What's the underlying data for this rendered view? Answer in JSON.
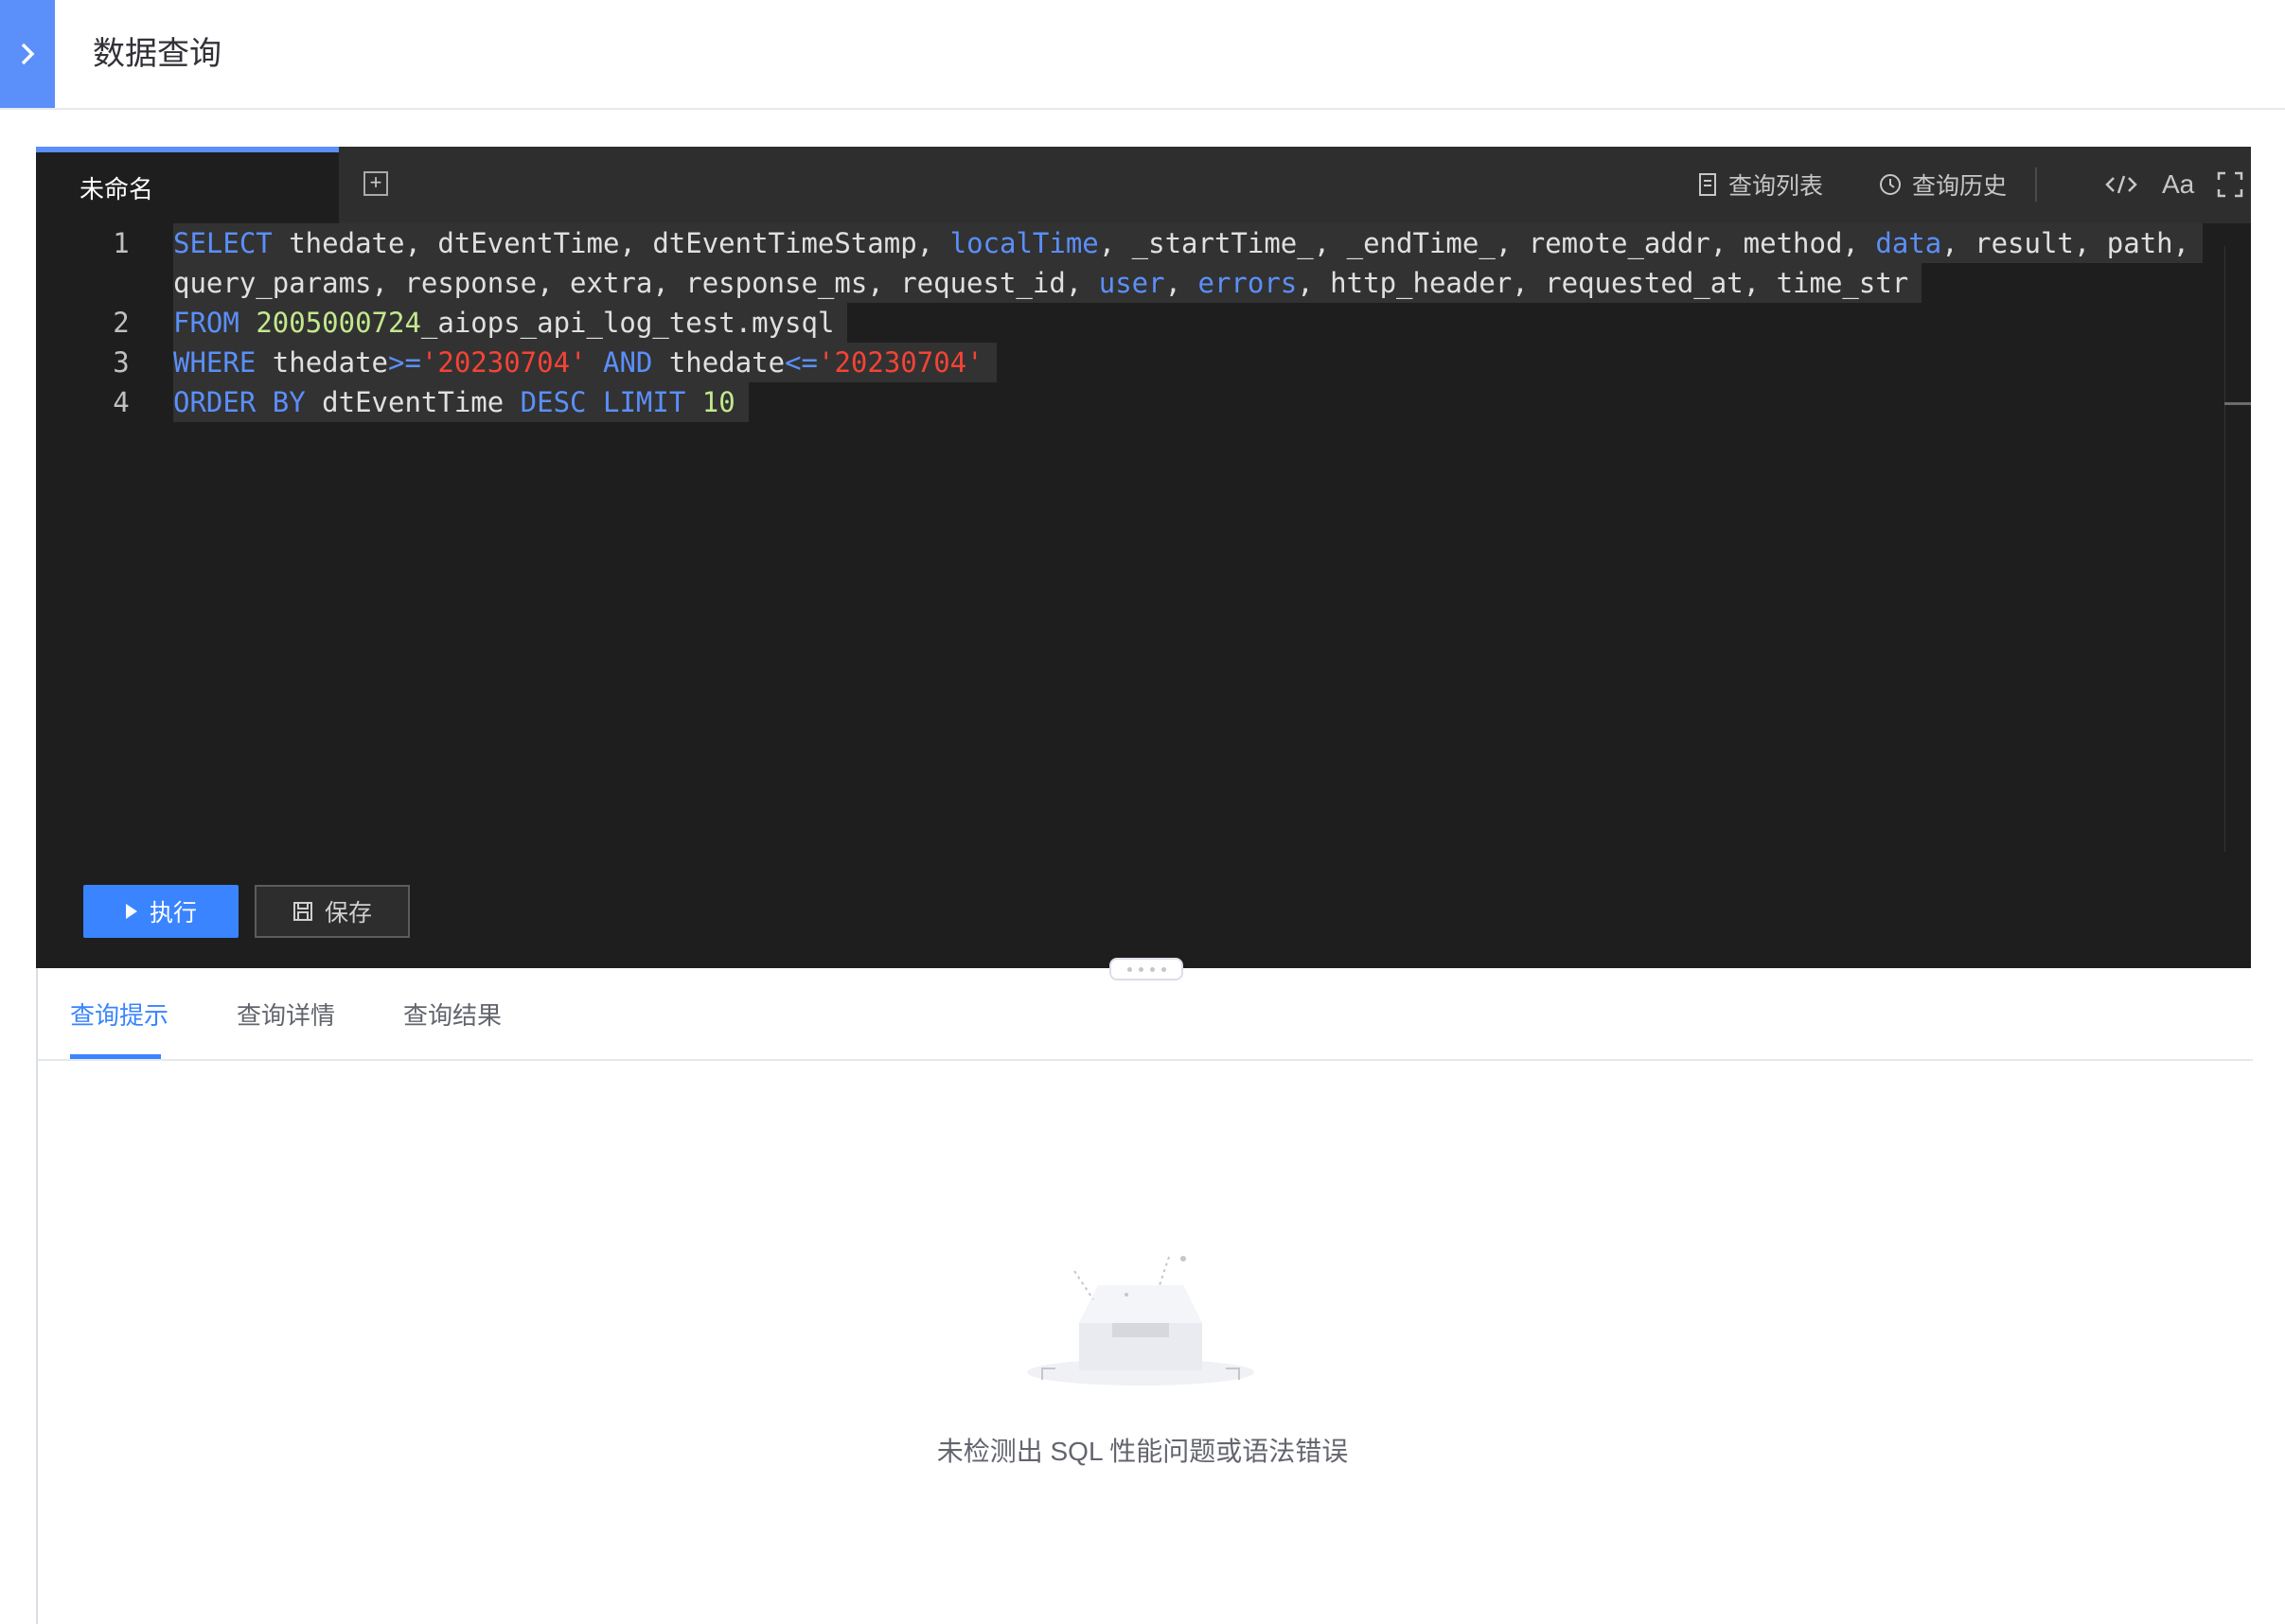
{
  "header": {
    "toggle_icon": "chevron-right-icon",
    "title": "数据查询"
  },
  "editor": {
    "tab_label": "未命名",
    "toolbar": {
      "query_list": "查询列表",
      "query_history": "查询历史",
      "font_label": "Aa"
    },
    "line_numbers": [
      "1",
      "2",
      "3",
      "4"
    ],
    "sql": {
      "l1a_kw": "SELECT",
      "l1a_rest": " thedate, dtEventTime, dtEventTimeStamp, ",
      "l1a_kw2": "localTime",
      "l1a_rest2": ", _startTime_, _endTime_, remote_addr, method, ",
      "l1a_kw3": "data",
      "l1a_rest3": ", result, path,",
      "l1b_a": "query_params, response, extra, response_ms, request_id, ",
      "l1b_kw": "user",
      "l1b_b": ", ",
      "l1b_kw2": "errors",
      "l1b_c": ", http_header, requested_at, time_str",
      "l2_kw": "FROM",
      "l2_num": "2005000724",
      "l2_rest": "_aiops_api_log_test.mysql",
      "l3_kw": "WHERE",
      "l3_a": " thedate",
      "l3_op": ">=",
      "l3_str": "'20230704'",
      "l3_kw2": "AND",
      "l3_b": " thedate",
      "l3_op2": "<=",
      "l3_str2": "'20230704'",
      "l4_kw": "ORDER BY",
      "l4_a": " dtEventTime ",
      "l4_kw2": "DESC",
      "l4_kw3": "LIMIT",
      "l4_num": "10"
    },
    "run_label": "执行",
    "save_label": "保存"
  },
  "results": {
    "tabs": [
      "查询提示",
      "查询详情",
      "查询结果"
    ],
    "active_tab": "查询提示",
    "empty_message": "未检测出 SQL 性能问题或语法错误"
  },
  "colors": {
    "accent": "#3a84ff",
    "editor_bg": "#1e1e1e",
    "keyword": "#5b8ff9",
    "string": "#f44336",
    "number": "#c3e88d"
  }
}
